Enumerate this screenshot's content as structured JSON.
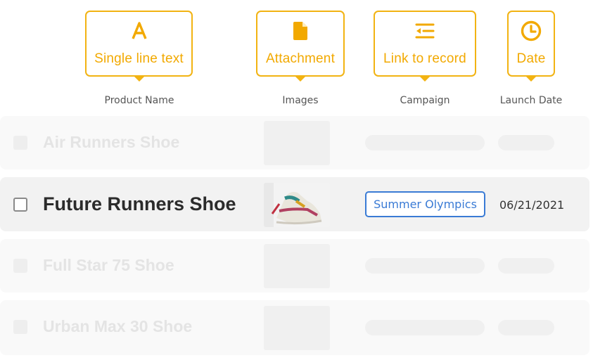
{
  "field_types": [
    {
      "label": "Single line text",
      "icon": "letter-a-icon"
    },
    {
      "label": "Attachment",
      "icon": "document-icon"
    },
    {
      "label": "Link to record",
      "icon": "linked-list-icon"
    },
    {
      "label": "Date",
      "icon": "clock-icon"
    }
  ],
  "columns": [
    "Product Name",
    "Images",
    "Campaign",
    "Launch Date"
  ],
  "rows": [
    {
      "name": "Air Runners Shoe"
    },
    {
      "name": "Future Runners Shoe",
      "campaign": "Summer Olympics",
      "launch_date": "06/21/2021"
    },
    {
      "name": "Full Star 75 Shoe"
    },
    {
      "name": "Urban Max 30 Shoe"
    }
  ],
  "colors": {
    "accent": "#f2b312",
    "link": "#3a7bd5"
  }
}
